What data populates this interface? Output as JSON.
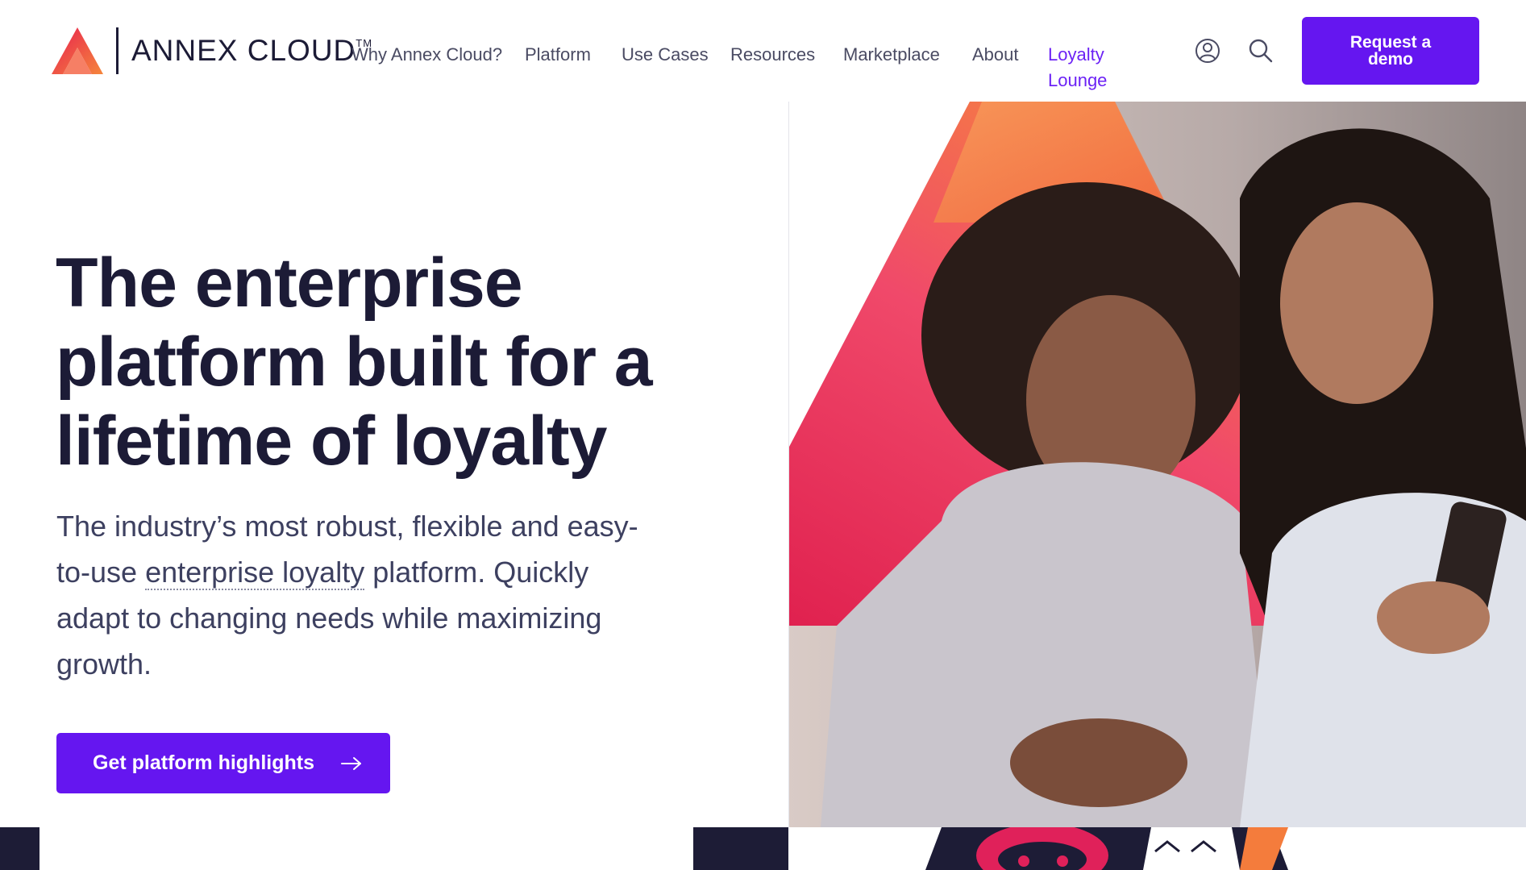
{
  "brand": {
    "name": "ANNEX CLOUD",
    "tm": "TM",
    "colors": {
      "primary": "#6516f0",
      "dark": "#1c1b36",
      "accent_red": "#e8334a",
      "accent_orange": "#f47c3c"
    }
  },
  "nav": {
    "items": [
      {
        "label": "Why Annex Cloud?",
        "accent": false
      },
      {
        "label": "Platform",
        "accent": false
      },
      {
        "label": "Use Cases",
        "accent": false
      },
      {
        "label": "Resources",
        "accent": false
      },
      {
        "label": "Marketplace",
        "accent": false
      },
      {
        "label": "About",
        "accent": false
      },
      {
        "label": "Loyalty Lounge",
        "accent": true
      }
    ],
    "icons": [
      "user-icon",
      "search-icon"
    ],
    "cta_label": "Request a demo"
  },
  "hero": {
    "title": "The enterprise platform built for a lifetime of loyalty",
    "subtitle_before": "The industry’s most robust, flexible and easy-to-use ",
    "subtitle_link": "enterprise loyalty",
    "subtitle_after": " platform. Quickly adapt to changing needs while maximizing growth.",
    "cta_label": "Get platform highlights",
    "cta_icon": "arrow-right-icon"
  }
}
